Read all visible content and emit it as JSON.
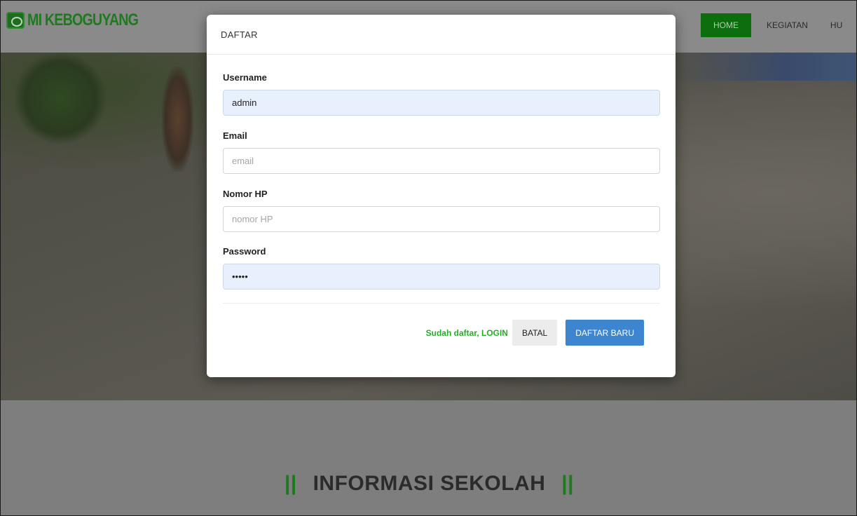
{
  "navbar": {
    "brand": "MI KEBOGUYANG",
    "items": [
      {
        "label": "HOME",
        "active": true
      },
      {
        "label": "KEGIATAN",
        "active": false
      },
      {
        "label": "HU",
        "active": false
      }
    ],
    "accent_color": "#0b6d0b"
  },
  "modal": {
    "title": "DAFTAR",
    "fields": {
      "username": {
        "label": "Username",
        "value": "admin",
        "placeholder": ""
      },
      "email": {
        "label": "Email",
        "value": "",
        "placeholder": "email"
      },
      "phone": {
        "label": "Nomor HP",
        "value": "",
        "placeholder": "nomor HP"
      },
      "password": {
        "label": "Password",
        "value": "•••••",
        "placeholder": ""
      }
    },
    "login_link": "Sudah daftar, LOGIN",
    "cancel_label": "BATAL",
    "submit_label": "DAFTAR BARU",
    "primary_color": "#3d86cf",
    "link_color": "#22b022"
  },
  "info": {
    "bar_left": "||",
    "title": "INFORMASI SEKOLAH",
    "bar_right": "||"
  }
}
